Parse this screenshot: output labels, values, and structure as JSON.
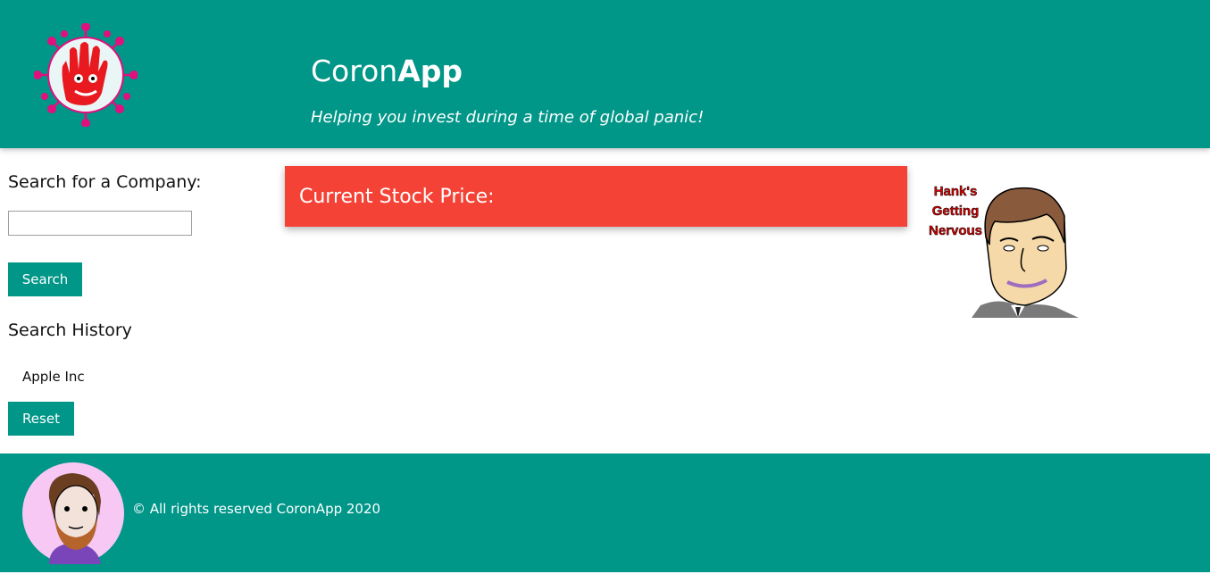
{
  "header": {
    "brand_regular": "Coron",
    "brand_bold": "App",
    "tagline": "Helping you invest during a time of global panic!"
  },
  "sidebar": {
    "search_title": "Search for a Company:",
    "search_value": "",
    "search_button": "Search",
    "history_title": "Search History",
    "history_items": [
      "Apple Inc"
    ],
    "reset_button": "Reset"
  },
  "main": {
    "price_label": "Current Stock Price:"
  },
  "side_image": {
    "caption_lines": [
      "Hank's",
      "Getting",
      "Nervous"
    ]
  },
  "footer": {
    "copyright": "© All rights reserved CoronApp 2020"
  },
  "colors": {
    "primary": "#009688",
    "price_card": "#f44336"
  },
  "icons": {
    "logo": "virus-hand-logo-icon",
    "hank": "hank-cartoon-image",
    "avatar": "author-avatar-icon"
  }
}
